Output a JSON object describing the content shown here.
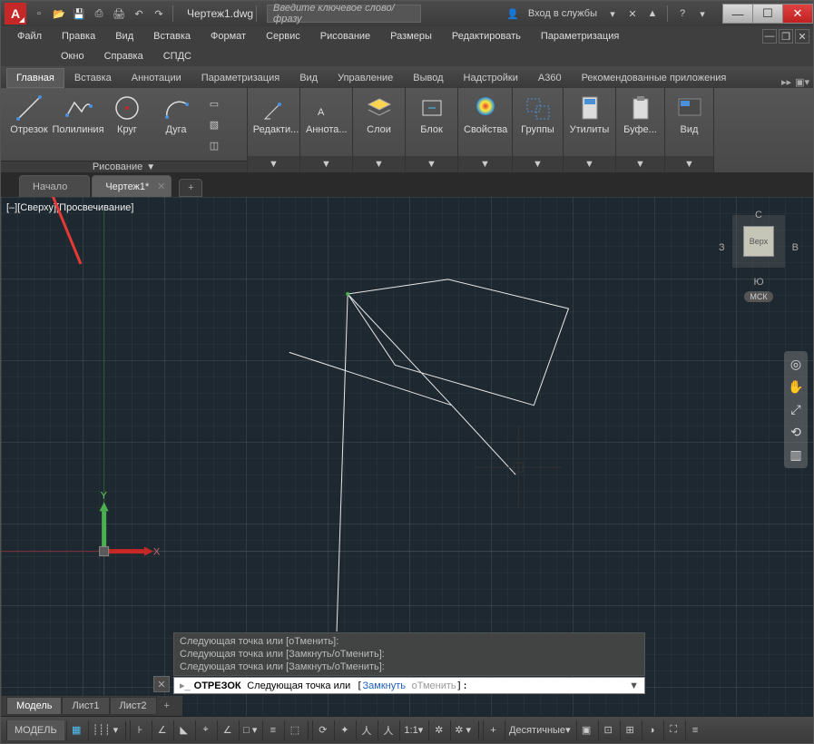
{
  "titlebar": {
    "doc": "Чертеж1.dwg",
    "search_placeholder": "Введите ключевое слово/фразу",
    "login": "Вход в службы"
  },
  "menus": {
    "row1": [
      "Файл",
      "Правка",
      "Вид",
      "Вставка",
      "Формат",
      "Сервис",
      "Рисование",
      "Размеры",
      "Редактировать",
      "Параметризация"
    ],
    "row2": [
      "Окно",
      "Справка",
      "СПДС"
    ]
  },
  "ribbon_tabs": [
    "Главная",
    "Вставка",
    "Аннотации",
    "Параметризация",
    "Вид",
    "Управление",
    "Вывод",
    "Надстройки",
    "A360",
    "Рекомендованные приложения"
  ],
  "panels": {
    "draw": {
      "title": "Рисование",
      "tools": [
        "Отрезок",
        "Полилиния",
        "Круг",
        "Дуга"
      ]
    },
    "edit": "Редакти...",
    "annot": "Аннота...",
    "layers": "Слои",
    "block": "Блок",
    "props": "Свойства",
    "groups": "Группы",
    "utils": "Утилиты",
    "buf": "Буфе...",
    "view": "Вид"
  },
  "doc_tabs": [
    "Начало",
    "Чертеж1*"
  ],
  "viewport": {
    "label": "[–][Сверху][Просвечивание]",
    "cube": "Верх",
    "n": "С",
    "s": "Ю",
    "e": "В",
    "w": "З",
    "cs": "МСК",
    "axis_x": "X",
    "axis_y": "Y"
  },
  "command": {
    "history": [
      "Следующая точка или [оТменить]:",
      "Следующая точка или [Замкнуть/оТменить]:",
      "Следующая точка или [Замкнуть/оТменить]:"
    ],
    "prompt_cmd": "ОТРЕЗОК",
    "prompt_text": "Следующая точка или",
    "opt1": "Замкнуть",
    "opt2": "оТменить"
  },
  "layout_tabs": [
    "Модель",
    "Лист1",
    "Лист2"
  ],
  "status": {
    "model": "МОДЕЛЬ",
    "scale": "1:1",
    "units": "Десятичные"
  }
}
